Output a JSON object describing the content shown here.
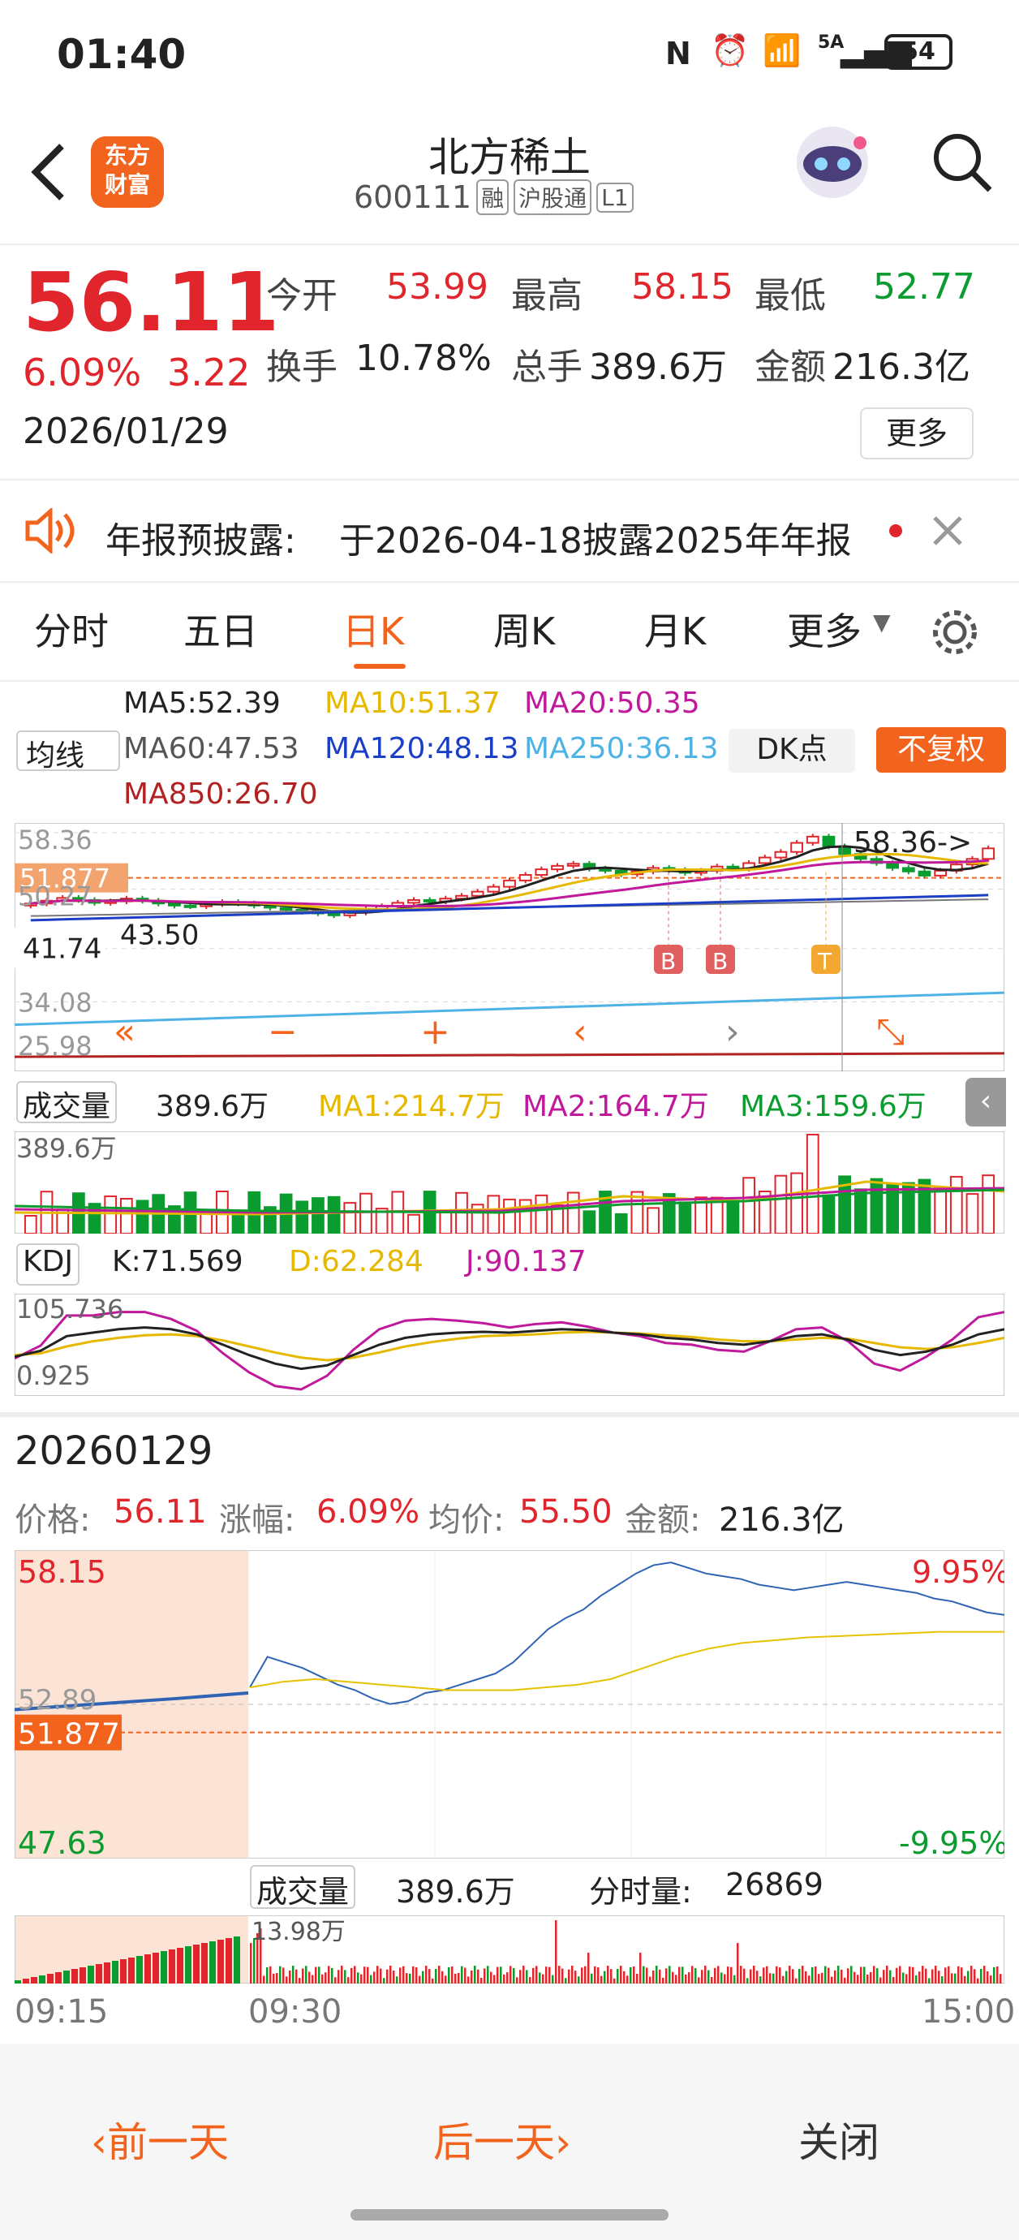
{
  "status_bar": {
    "time": "01:40",
    "battery": "54",
    "network": "5A"
  },
  "header": {
    "title": "北方稀土",
    "code": "600111",
    "badges": [
      "融",
      "沪股通",
      "L1"
    ],
    "logo_line1": "东方",
    "logo_line2": "财富"
  },
  "quote": {
    "price": "56.11",
    "change_pct": "6.09%",
    "change_amt": "3.22",
    "date": "2026/01/29",
    "open_label": "今开",
    "open": "53.99",
    "high_label": "最高",
    "high": "58.15",
    "low_label": "最低",
    "low": "52.77",
    "turnover_label": "换手",
    "turnover": "10.78%",
    "volume_label": "总手",
    "volume": "389.6万",
    "amount_label": "金额",
    "amount": "216.3亿",
    "more": "更多"
  },
  "notice": {
    "label": "年报预披露:",
    "text": "于2026-04-18披露2025年年报"
  },
  "tabs": [
    "分时",
    "五日",
    "日K",
    "周K",
    "月K",
    "更多"
  ],
  "active_tab": 2,
  "ma_bar": {
    "selector": "均线",
    "ma5": "MA5:52.39",
    "ma10": "MA10:51.37",
    "ma20": "MA20:50.35",
    "ma60": "MA60:47.53",
    "ma120": "MA120:48.13",
    "ma250": "MA250:36.13",
    "ma850": "MA850:26.70",
    "dk": "DK点",
    "fq": "不复权"
  },
  "kchart": {
    "levels": [
      "58.36",
      "51.877",
      "50.27",
      "43.50",
      "41.74",
      "34.08",
      "25.98"
    ],
    "max_label": "58.36->",
    "markers": [
      "B",
      "B",
      "T"
    ],
    "closes": [
      48.2,
      48.6,
      49.0,
      48.7,
      48.3,
      48.5,
      48.9,
      48.6,
      48.2,
      47.9,
      47.8,
      48.1,
      48.4,
      48.2,
      47.9,
      47.6,
      47.3,
      47.0,
      46.8,
      46.5,
      46.9,
      47.4,
      47.8,
      48.3,
      48.7,
      48.5,
      48.9,
      49.3,
      49.9,
      50.6,
      51.5,
      52.3,
      53.1,
      53.6,
      53.9,
      53.2,
      52.9,
      52.4,
      52.8,
      53.3,
      53.0,
      52.6,
      52.9,
      53.5,
      53.2,
      54.0,
      54.8,
      55.6,
      56.9,
      57.8,
      56.4,
      55.3,
      54.6,
      54.0,
      53.3,
      52.8,
      52.2,
      52.9,
      53.8,
      54.6,
      56.11
    ]
  },
  "volume_panel": {
    "selector": "成交量",
    "vol": "389.6万",
    "ma1": "MA1:214.7万",
    "ma2": "MA2:164.7万",
    "ma3": "MA3:159.6万",
    "max": "389.6万"
  },
  "kdj_panel": {
    "selector": "KDJ",
    "k": "K:71.569",
    "d": "D:62.284",
    "j": "J:90.137",
    "max": "105.736",
    "min": "0.925",
    "k_vals": [
      38,
      45,
      62,
      66,
      70,
      72,
      70,
      64,
      52,
      40,
      30,
      24,
      28,
      40,
      52,
      60,
      64,
      66,
      67,
      66,
      68,
      70,
      69,
      66,
      64,
      60,
      58,
      54,
      52,
      56,
      62,
      64,
      58,
      46,
      40,
      44,
      52,
      64,
      70
    ],
    "d_vals": [
      40,
      42,
      50,
      56,
      60,
      63,
      64,
      62,
      57,
      50,
      43,
      37,
      34,
      37,
      43,
      50,
      55,
      59,
      62,
      63,
      64,
      66,
      67,
      66,
      65,
      63,
      61,
      58,
      56,
      56,
      58,
      60,
      59,
      54,
      49,
      47,
      49,
      54,
      60
    ],
    "j_vals": [
      36,
      51,
      86,
      86,
      90,
      90,
      82,
      68,
      42,
      20,
      4,
      0,
      16,
      46,
      70,
      80,
      82,
      80,
      77,
      72,
      76,
      78,
      73,
      66,
      62,
      54,
      52,
      46,
      44,
      56,
      70,
      72,
      56,
      30,
      22,
      38,
      58,
      84,
      90
    ]
  },
  "detail": {
    "date": "20260129",
    "price_label": "价格:",
    "price": "56.11",
    "chg_label": "涨幅:",
    "chg": "6.09%",
    "avg_label": "均价:",
    "avg": "55.50",
    "amt_label": "金额:",
    "amt": "216.3亿"
  },
  "intraday": {
    "high": "58.15",
    "ref": "51.877",
    "low": "47.63",
    "up_pct": "9.95%",
    "down_pct": "-9.95%",
    "mid": "52.89",
    "vol_selector": "成交量",
    "vol": "389.6万",
    "fsl_label": "分时量:",
    "fsl": "26869",
    "vol_max": "13.98万",
    "t_start": "09:15",
    "t_open": "09:30",
    "t_end": "15:00",
    "price_pts": [
      53.5,
      54.6,
      54.4,
      54.2,
      53.9,
      53.6,
      53.4,
      53.1,
      52.9,
      53.0,
      53.3,
      53.4,
      53.6,
      53.8,
      54.0,
      54.4,
      55.0,
      55.6,
      56.0,
      56.3,
      56.8,
      57.2,
      57.6,
      57.9,
      58.0,
      57.8,
      57.6,
      57.5,
      57.4,
      57.2,
      57.1,
      57.0,
      57.1,
      57.2,
      57.3,
      57.2,
      57.1,
      57.0,
      56.9,
      56.7,
      56.6,
      56.4,
      56.2,
      56.11
    ],
    "avg_pts": [
      53.5,
      53.7,
      53.8,
      53.7,
      53.6,
      53.5,
      53.4,
      53.4,
      53.4,
      53.5,
      53.6,
      53.8,
      54.2,
      54.6,
      54.9,
      55.1,
      55.2,
      55.3,
      55.35,
      55.4,
      55.45,
      55.5,
      55.5,
      55.5
    ]
  },
  "footer": {
    "prev": "前一天",
    "next": "后一天",
    "close": "关闭"
  },
  "colors": {
    "up": "#e0262c",
    "down": "#0b9c2f",
    "accent": "#f2641e"
  }
}
